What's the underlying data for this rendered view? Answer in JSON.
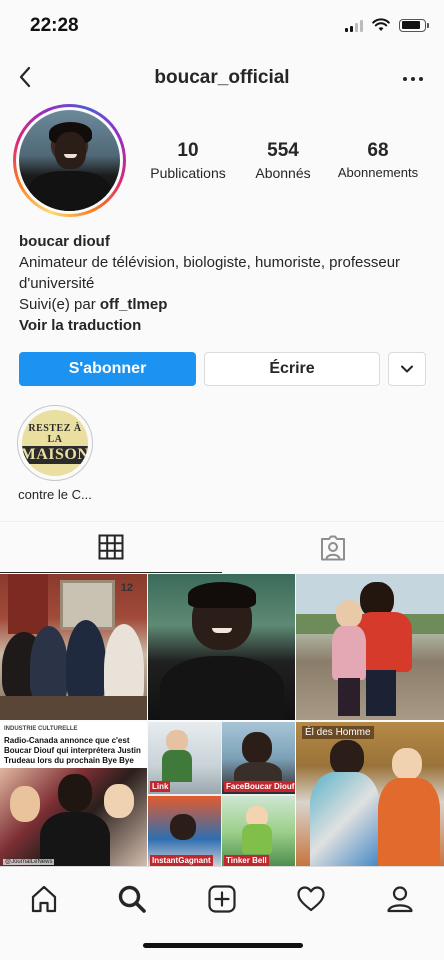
{
  "status_bar": {
    "time": "22:28",
    "battery_level": 0.85,
    "signal_bars_active": 2,
    "icons": [
      "signal-icon",
      "wifi-icon",
      "battery-icon"
    ]
  },
  "nav": {
    "title": "boucar_official",
    "back_icon": "chevron-left-icon",
    "more_icon": "more-horizontal-icon"
  },
  "stats": [
    {
      "value": "10",
      "label": "Publications"
    },
    {
      "value": "554",
      "label": "Abonnés"
    },
    {
      "value": "68",
      "label": "Abonnements"
    }
  ],
  "bio": {
    "name": "boucar diouf",
    "description": "Animateur de télévision, biologiste, humoriste, professeur d'université",
    "followed_by_prefix": "Suivi(e) par ",
    "followed_by_user": "off_tlmep",
    "translate_link": "Voir la traduction"
  },
  "actions": {
    "follow": "S'abonner",
    "message": "Écrire",
    "dropdown_icon": "chevron-down-icon"
  },
  "highlights": [
    {
      "label": "contre le C...",
      "cover_line1": "RESTEZ À LA",
      "cover_line2": "MAISON"
    }
  ],
  "tabs": [
    {
      "icon": "grid-icon",
      "active": true
    },
    {
      "icon": "tagged-user-icon",
      "active": false
    }
  ],
  "posts": {
    "news": {
      "kicker": "INDUSTRIE CULTURELLE",
      "headline": "Radio-Canada annonce que c'est Boucar Diouf qui interprétera Justin Trudeau lors du prochain Bye Bye",
      "footer": "@JournalLeNews"
    },
    "collage_labels": [
      "Link",
      "FaceBoucar Diouf",
      "InstantGagnant",
      "Tinker Bell"
    ],
    "sign_text": "Él des Homme",
    "doorplate": "12"
  },
  "bottom_nav": [
    "home-icon",
    "search-icon",
    "new-post-icon",
    "heart-icon",
    "profile-icon"
  ],
  "colors": {
    "follow_button": "#1c93f0",
    "text": "#262626",
    "border": "#dbdbdb"
  }
}
